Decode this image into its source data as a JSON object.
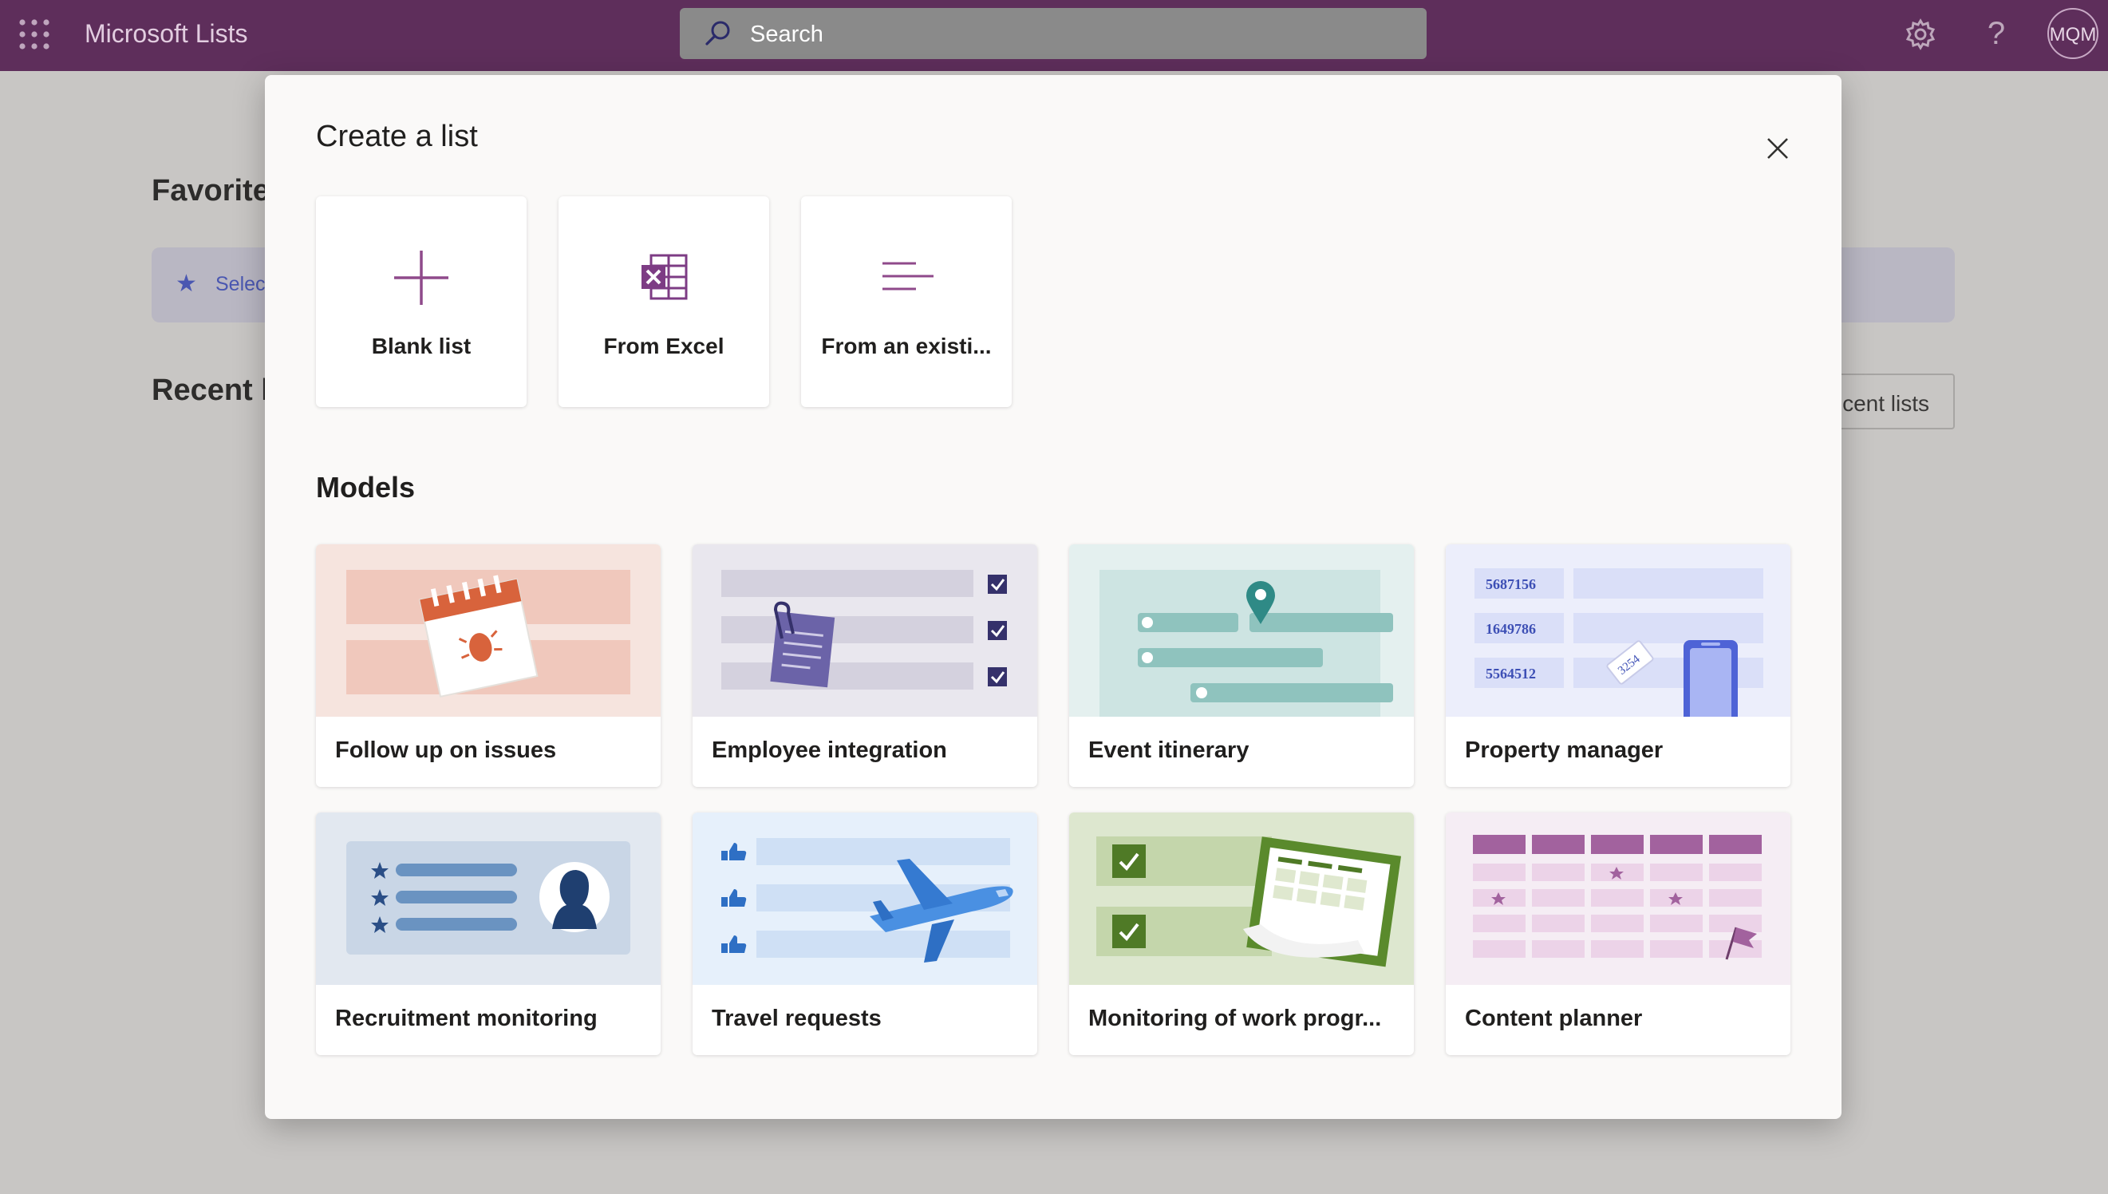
{
  "topbar": {
    "app_title": "Microsoft Lists",
    "search_placeholder": "Search",
    "help_glyph": "?",
    "avatar_initials": "MQM",
    "icons": [
      "waffle-icon",
      "search-icon",
      "gear-icon",
      "help-icon"
    ]
  },
  "background": {
    "favorites_heading": "Favorite",
    "favorites_hint": "Selec",
    "recent_heading": "Recent l",
    "recent_button": "cent lists"
  },
  "dialog": {
    "title": "Create a list",
    "create_options": [
      {
        "label": "Blank list",
        "icon": "plus-icon"
      },
      {
        "label": "From Excel",
        "icon": "excel-icon"
      },
      {
        "label": "From an existi...",
        "icon": "existing-list-icon"
      }
    ],
    "models_heading": "Models",
    "templates": [
      {
        "label": "Follow up on issues",
        "bg": "#f6e4de"
      },
      {
        "label": "Employee integration",
        "bg": "#e9e7ee"
      },
      {
        "label": "Event itinerary",
        "bg": "#e4f0ef"
      },
      {
        "label": "Property manager",
        "bg": "#eceefb"
      },
      {
        "label": "Recruitment monitoring",
        "bg": "#e2e8f0"
      },
      {
        "label": "Travel requests",
        "bg": "#e6f0fb"
      },
      {
        "label": "Monitoring of work progr...",
        "bg": "#dde7cf"
      },
      {
        "label": "Content planner",
        "bg": "#f5edf4"
      }
    ],
    "thumbnail_text": {
      "property_numbers": [
        "5687156",
        "1649786",
        "5564512"
      ],
      "tag_number": "3254"
    }
  },
  "colors": {
    "topbar": "#5e2e5b",
    "accent_purple": "#8f4a8b",
    "excel_purple": "#7d3c84",
    "overlay": "#c8c6c4"
  }
}
